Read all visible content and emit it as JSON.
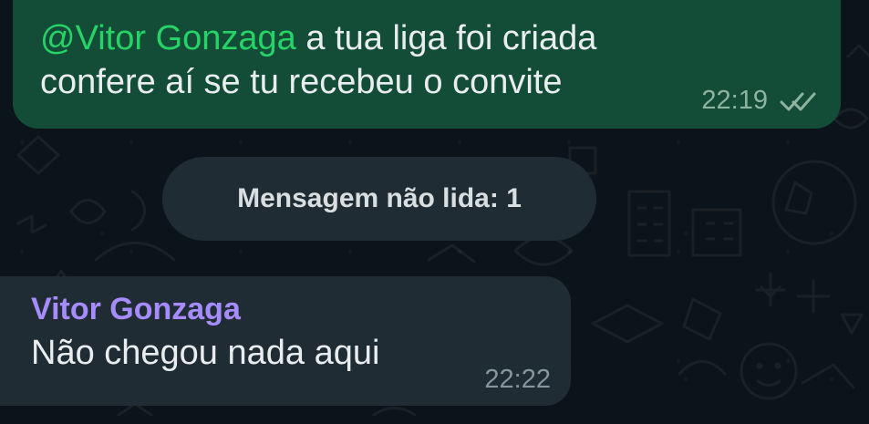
{
  "chat": {
    "outgoing_message": {
      "mention": "@Vitor Gonzaga",
      "line1_rest": " a tua liga foi criada",
      "line2": "confere aí se tu recebeu o convite",
      "time": "22:19",
      "status_icon": "double-check-icon"
    },
    "unread_separator": {
      "label": "Mensagem não lida: 1"
    },
    "incoming_message": {
      "sender": "Vitor Gonzaga",
      "text": "Não chegou nada aqui",
      "time": "22:22"
    }
  },
  "colors": {
    "background": "#0b141a",
    "outgoing_bubble": "#144d37",
    "incoming_bubble": "#202c33",
    "mention": "#25d366",
    "sender_name": "#a68cff"
  }
}
